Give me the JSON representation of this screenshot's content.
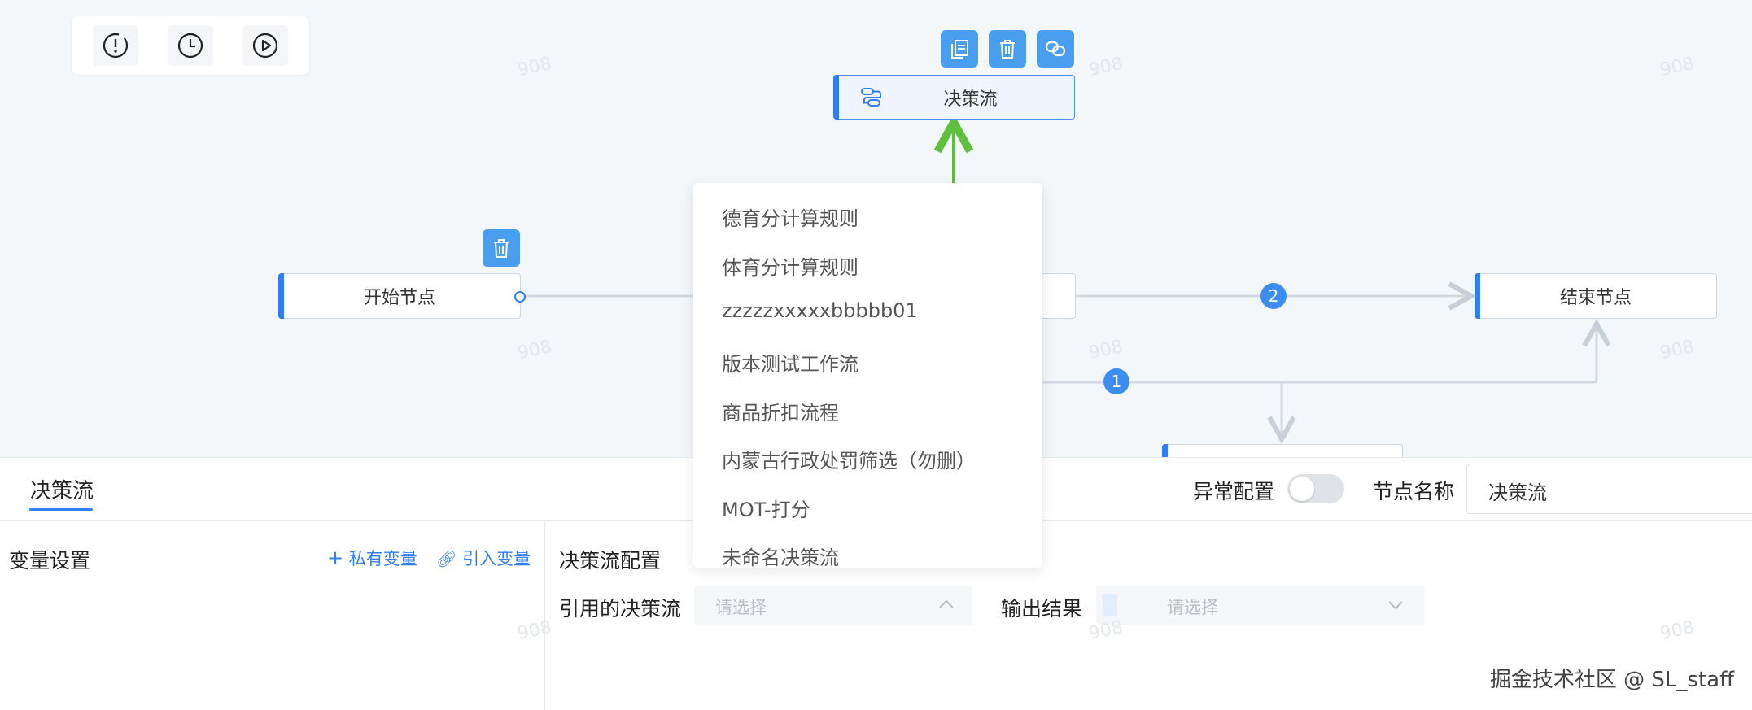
{
  "toolbar": {
    "items": [
      {
        "icon": "alert-circle-icon"
      },
      {
        "icon": "clock-icon"
      },
      {
        "icon": "play-circle-icon"
      }
    ]
  },
  "watermark": "908",
  "nodes": {
    "start": {
      "label": "开始节点"
    },
    "decision": {
      "label": "决策流"
    },
    "end": {
      "label": "结束节点"
    }
  },
  "badges": {
    "one": "1",
    "two": "2"
  },
  "colors": {
    "accent": "#2f7ff2",
    "success_edge": "#5cc03c",
    "canvas_bg": "#f4f7fa"
  },
  "dropdown": {
    "options": [
      "德育分计算规则",
      "体育分计算规则",
      "zzzzzxxxxxbbbbb01",
      "版本测试工作流",
      "商品折扣流程",
      "内蒙古行政处罚筛选（勿删）",
      "MOT-打分",
      "未命名决策流"
    ]
  },
  "panel": {
    "tab": "决策流",
    "exception_label": "异常配置",
    "node_name_label": "节点名称",
    "node_name_value": "决策流",
    "variables": {
      "title": "变量设置",
      "private_link": "私有变量",
      "import_link": "引入变量"
    },
    "config": {
      "title": "决策流配置",
      "ref_label": "引用的决策流",
      "ref_placeholder": "请选择",
      "output_label": "输出结果",
      "output_placeholder": "请选择"
    }
  },
  "credit": "掘金技术社区 @ SL_staff"
}
